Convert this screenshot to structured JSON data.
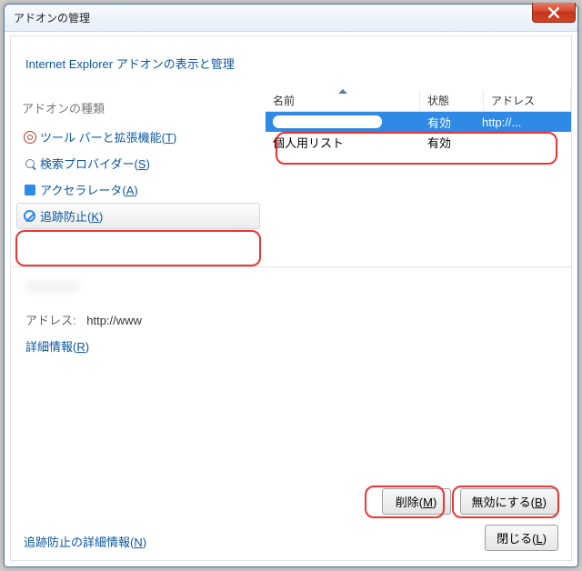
{
  "window": {
    "title": "アドオンの管理"
  },
  "header": {
    "link": "Internet Explorer アドオンの表示と管理"
  },
  "sidebar": {
    "title": "アドオンの種類",
    "items": [
      {
        "label": "ツール バーと拡張機能(",
        "hotkey": "T",
        "suffix": ")"
      },
      {
        "label": "検索プロバイダー(",
        "hotkey": "S",
        "suffix": ")"
      },
      {
        "label": "アクセラレータ(",
        "hotkey": "A",
        "suffix": ")"
      },
      {
        "label": "追跡防止(",
        "hotkey": "K",
        "suffix": ")"
      }
    ]
  },
  "list": {
    "columns": {
      "name": "名前",
      "status": "状態",
      "address": "アドレス"
    },
    "rows": [
      {
        "name": "",
        "status": "有効",
        "address": "http://..."
      },
      {
        "name": "個人用リスト",
        "status": "有効",
        "address": ""
      }
    ]
  },
  "details": {
    "address_label": "アドレス:",
    "address_value": "http://www",
    "more_info": "詳細情報(",
    "more_info_hotkey": "R",
    "more_info_suffix": ")"
  },
  "footer": {
    "link": "追跡防止の詳細情報(",
    "link_hotkey": "N",
    "link_suffix": ")",
    "delete": "削除(",
    "delete_hotkey": "M",
    "delete_suffix": ")",
    "disable": "無効にする(",
    "disable_hotkey": "B",
    "disable_suffix": ")",
    "close": "閉じる(",
    "close_hotkey": "L",
    "close_suffix": ")"
  }
}
